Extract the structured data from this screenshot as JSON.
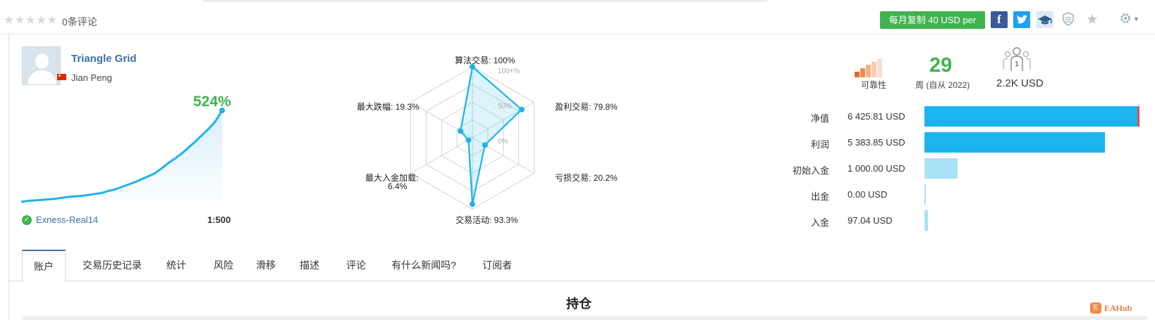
{
  "header": {
    "rating_stars": "★★★★★",
    "reviews": "0条评论",
    "copy_button": "每月复制 40 USD per",
    "facebook": "f",
    "twitter": "🐦",
    "icons": [
      "star-rating-icon",
      "facebook-icon",
      "twitter-icon",
      "graduation-cap-icon",
      "shield-icon",
      "favorite-star-icon",
      "gear-icon"
    ]
  },
  "profile": {
    "signal_name": "Triangle Grid",
    "author": "Jian Peng",
    "growth": "524%",
    "account": "Exness-Real14",
    "leverage": "1:500"
  },
  "growth_chart": {
    "type": "area",
    "values": [
      0,
      2,
      3,
      4,
      5,
      6,
      8,
      10,
      11,
      12,
      14,
      16,
      18,
      22,
      25,
      30,
      35,
      40,
      46,
      52,
      58,
      68,
      79,
      88,
      98,
      110,
      122,
      135,
      148,
      163,
      185
    ]
  },
  "radar": {
    "labels": {
      "algo": "算法交易: 100%",
      "profit_trades": "盈利交易: 79.8%",
      "loss_trades": "亏损交易: 20.2%",
      "activity": "交易活动: 93.3%",
      "max_load": "最大入金加载:",
      "max_load_val": "6.4%",
      "max_drawdown": "最大跌幅: 19.3%"
    },
    "scale": [
      "100+%",
      "50%",
      "0%"
    ]
  },
  "chart_data": {
    "type": "radar",
    "categories": [
      "算法交易",
      "盈利交易",
      "亏损交易",
      "交易活动",
      "最大入金加载",
      "最大跌幅"
    ],
    "values": [
      100,
      79.8,
      20.2,
      93.3,
      6.4,
      19.3
    ],
    "ylim": [
      0,
      100
    ]
  },
  "stats": {
    "reliability_label": "可靠性",
    "weeks": "29",
    "weeks_label": "周 (自从 2022)",
    "subscribers_count": "1",
    "subscribers_funds": "2.2K USD",
    "reliability_colors": [
      "#e8662f",
      "#f08a4b",
      "#f4b28a",
      "#f7cdb3",
      "#f9ddcc"
    ]
  },
  "financials": [
    {
      "label": "净值",
      "value": "6 425.81 USD",
      "amount": 6425.81,
      "color": "#1db3ec"
    },
    {
      "label": "利润",
      "value": "5 383.85 USD",
      "amount": 5383.85,
      "color": "#1db3ec"
    },
    {
      "label": "初始入金",
      "value": "1 000.00 USD",
      "amount": 1000.0,
      "color": "#a9e1f7"
    },
    {
      "label": "出金",
      "value": "0.00 USD",
      "amount": 0.0,
      "color": "#a9e1f7"
    },
    {
      "label": "入金",
      "value": "97.04 USD",
      "amount": 97.04,
      "color": "#a9e1f7"
    }
  ],
  "tabs": [
    "账户",
    "交易历史记录",
    "统计",
    "风险",
    "滑移",
    "描述",
    "评论",
    "有什么新闻吗?",
    "订阅者"
  ],
  "section_title": "持仓",
  "watermark": "EAHub"
}
